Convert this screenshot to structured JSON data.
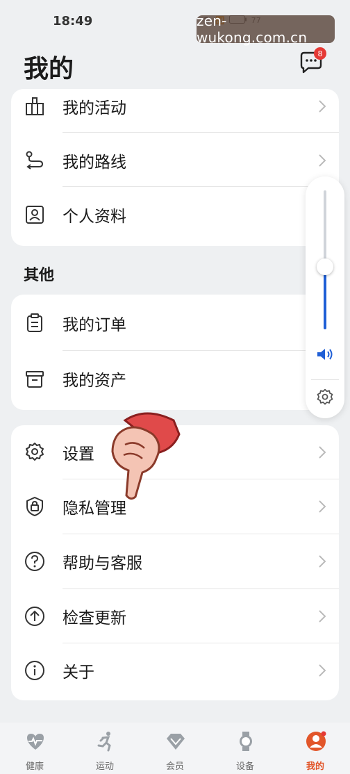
{
  "status_bar": {
    "time": "18:49",
    "battery": "77"
  },
  "watermark": "zen-wukong.com.cn",
  "header": {
    "title": "我的",
    "message_badge": "8"
  },
  "top_card": {
    "items": [
      {
        "label": "我的活动",
        "icon": "activity-icon"
      },
      {
        "label": "我的路线",
        "icon": "route-icon"
      },
      {
        "label": "个人资料",
        "icon": "profile-icon"
      }
    ]
  },
  "other_section": {
    "title": "其他",
    "items": [
      {
        "label": "我的订单",
        "icon": "orders-icon"
      },
      {
        "label": "我的资产",
        "icon": "assets-icon"
      }
    ]
  },
  "settings_card": {
    "items": [
      {
        "label": "设置",
        "icon": "gear-icon"
      },
      {
        "label": "隐私管理",
        "icon": "lock-icon"
      },
      {
        "label": "帮助与客服",
        "icon": "help-icon"
      },
      {
        "label": "检查更新",
        "icon": "update-icon"
      },
      {
        "label": "关于",
        "icon": "info-icon"
      }
    ]
  },
  "volume": {
    "level": 0.45,
    "accent": "#1f5fd6"
  },
  "tabbar": {
    "tabs": [
      {
        "label": "健康",
        "icon": "heart-icon"
      },
      {
        "label": "运动",
        "icon": "running-icon"
      },
      {
        "label": "会员",
        "icon": "diamond-icon"
      },
      {
        "label": "设备",
        "icon": "watch-icon"
      },
      {
        "label": "我的",
        "icon": "me-icon",
        "active": true
      }
    ],
    "active_color": "#e2562a"
  }
}
